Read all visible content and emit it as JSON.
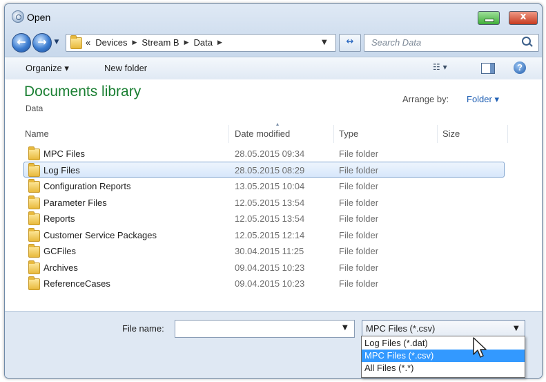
{
  "window": {
    "title": "Open",
    "minimize_icon": "minimize-icon",
    "close_label": "x"
  },
  "nav": {
    "back_icon": "back-arrow-icon",
    "forward_icon": "forward-arrow-icon",
    "back_glyph": "←",
    "forward_glyph": "→",
    "history_glyph": "▼",
    "address": {
      "prefix": "«",
      "crumbs": [
        "Devices",
        "Stream B",
        "Data"
      ],
      "separator": "▶",
      "dropdown_glyph": "▼"
    },
    "refresh_glyph": "↔",
    "search_placeholder": "Search Data"
  },
  "toolbar": {
    "organize_label": "Organize ▾",
    "new_folder_label": "New folder",
    "view_label": "☷ ▾",
    "help_label": "?"
  },
  "library": {
    "title": "Documents library",
    "subtitle": "Data",
    "arrange_label": "Arrange by:",
    "arrange_value": "Folder ▾"
  },
  "columns": {
    "name": "Name",
    "date": "Date modified",
    "type": "Type",
    "size": "Size",
    "sort_glyph": "▴"
  },
  "files": [
    {
      "name": "MPC Files",
      "date": "28.05.2015 09:34",
      "type": "File folder",
      "selected": false
    },
    {
      "name": "Log Files",
      "date": "28.05.2015 08:29",
      "type": "File folder",
      "selected": true
    },
    {
      "name": "Configuration Reports",
      "date": "13.05.2015 10:04",
      "type": "File folder",
      "selected": false
    },
    {
      "name": "Parameter Files",
      "date": "12.05.2015 13:54",
      "type": "File folder",
      "selected": false
    },
    {
      "name": "Reports",
      "date": "12.05.2015 13:54",
      "type": "File folder",
      "selected": false
    },
    {
      "name": "Customer Service Packages",
      "date": "12.05.2015 12:14",
      "type": "File folder",
      "selected": false
    },
    {
      "name": "GCFiles",
      "date": "30.04.2015 11:25",
      "type": "File folder",
      "selected": false
    },
    {
      "name": "Archives",
      "date": "09.04.2015 10:23",
      "type": "File folder",
      "selected": false
    },
    {
      "name": "ReferenceCases",
      "date": "09.04.2015 10:23",
      "type": "File folder",
      "selected": false
    }
  ],
  "footer": {
    "file_name_label": "File name:",
    "file_name_value": "",
    "file_name_dropdown": "▼",
    "filter_value": "MPC Files (*.csv)",
    "filter_dropdown": "▼",
    "filter_options": [
      {
        "label": "Log Files (*.dat)",
        "highlighted": false
      },
      {
        "label": "MPC Files (*.csv)",
        "highlighted": true
      },
      {
        "label": "All Files (*.*)",
        "highlighted": false
      }
    ]
  },
  "colors": {
    "library_title": "#1a7f32",
    "link": "#1f5fb4",
    "highlight": "#3399ff"
  }
}
